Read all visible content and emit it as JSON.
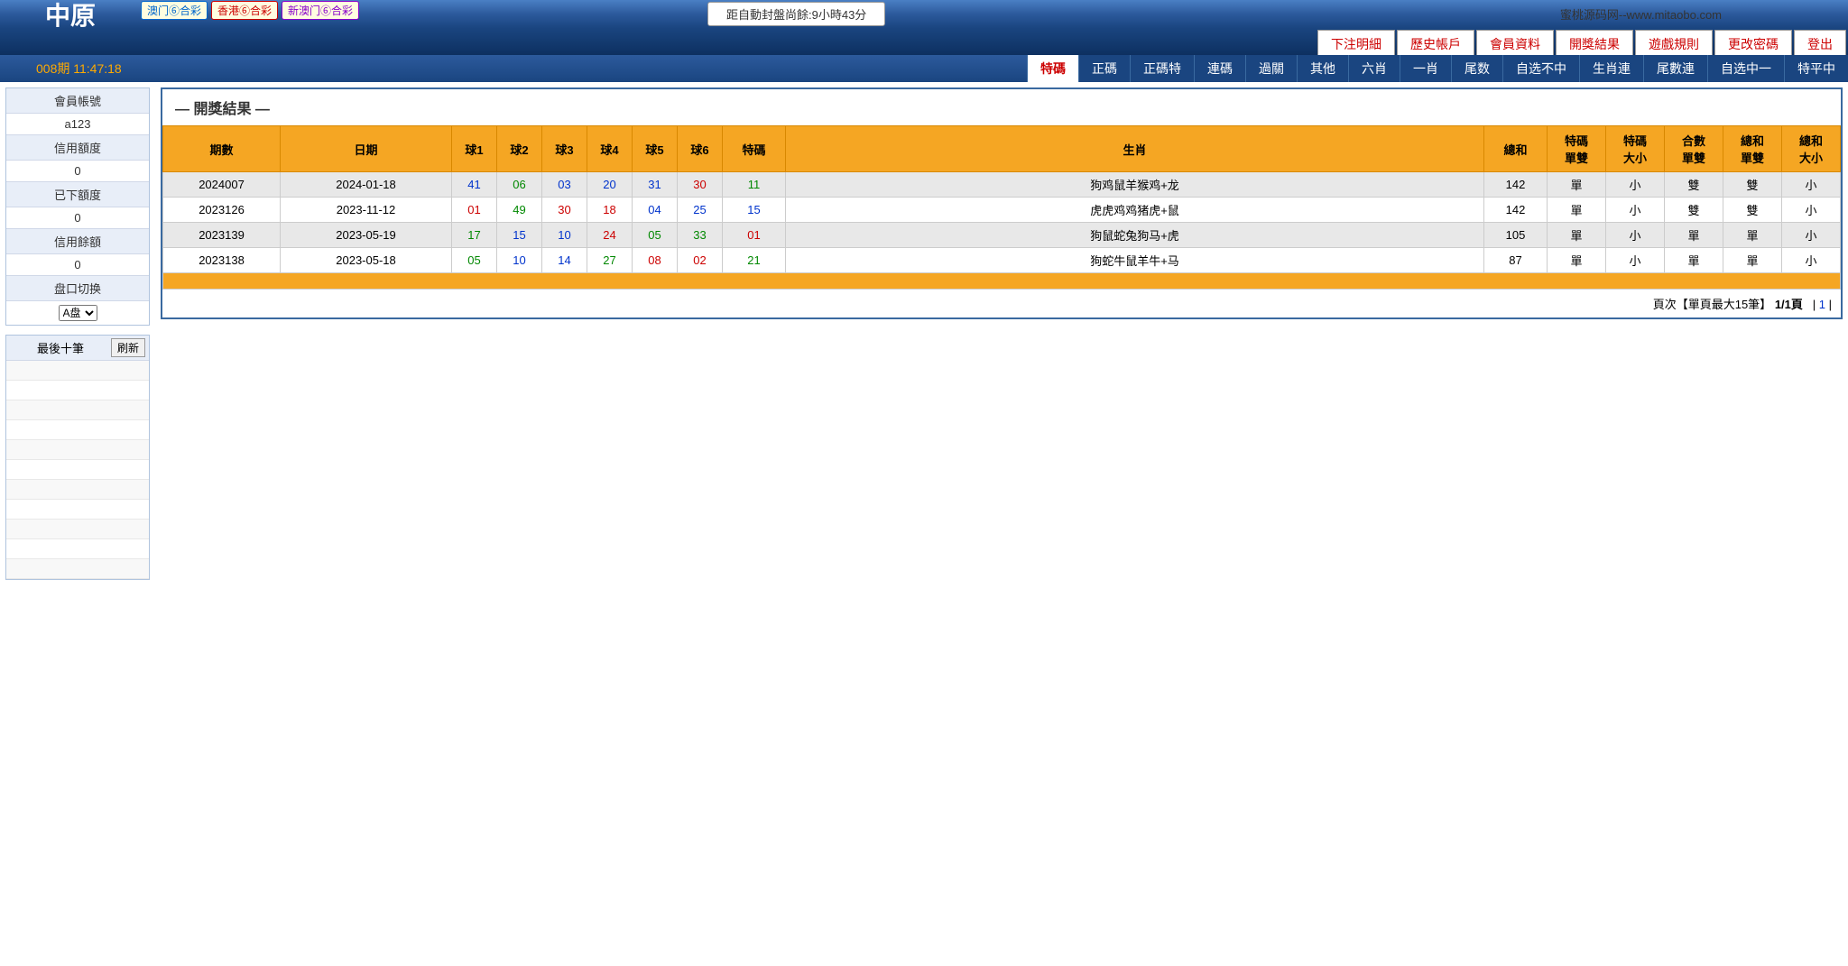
{
  "header": {
    "logo": "中原",
    "badges": [
      "澳门⑥合彩",
      "香港⑥合彩",
      "新澳门⑥合彩"
    ],
    "countdown": "距自動封盤尚餘:9小時43分",
    "site_info": "蜜桃源码网--www.mitaobo.com",
    "period_time": "008期 11:47:18"
  },
  "top_menu": [
    "下注明細",
    "歷史帳戶",
    "會員資料",
    "開獎結果",
    "遊戲規則",
    "更改密碼",
    "登出"
  ],
  "main_tabs": [
    "特碼",
    "正碼",
    "正碼特",
    "連碼",
    "過關",
    "其他",
    "六肖",
    "一肖",
    "尾数",
    "自选不中",
    "生肖連",
    "尾數連",
    "自选中一",
    "特平中"
  ],
  "active_tab_index": 0,
  "sidebar": {
    "labels": {
      "account": "會員帳號",
      "credit_limit": "信用額度",
      "placed": "已下額度",
      "remaining": "信用餘額",
      "market": "盘口切换"
    },
    "account_value": "a123",
    "credit_limit_value": "0",
    "placed_value": "0",
    "remaining_value": "0",
    "market_options": [
      "A盘"
    ],
    "recent_title": "最後十筆",
    "refresh_label": "刷新"
  },
  "results": {
    "title": "— 開獎結果 —",
    "headers": [
      "期數",
      "日期",
      "球1",
      "球2",
      "球3",
      "球4",
      "球5",
      "球6",
      "特碼",
      "生肖",
      "總和",
      "特碼單雙",
      "特碼大小",
      "合數單雙",
      "總和單雙",
      "總和大小"
    ],
    "rows": [
      {
        "period": "2024007",
        "date": "2024-01-18",
        "balls": [
          {
            "n": "41",
            "c": "blue"
          },
          {
            "n": "06",
            "c": "green"
          },
          {
            "n": "03",
            "c": "blue"
          },
          {
            "n": "20",
            "c": "blue"
          },
          {
            "n": "31",
            "c": "blue"
          },
          {
            "n": "30",
            "c": "red"
          },
          {
            "n": "11",
            "c": "green"
          }
        ],
        "zodiac": "狗鸡鼠羊猴鸡+龙",
        "sum": "142",
        "sp_oe": "單",
        "sp_bs": "小",
        "hs_oe": "雙",
        "sum_oe": "雙",
        "sum_bs": "小"
      },
      {
        "period": "2023126",
        "date": "2023-11-12",
        "balls": [
          {
            "n": "01",
            "c": "red"
          },
          {
            "n": "49",
            "c": "green"
          },
          {
            "n": "30",
            "c": "red"
          },
          {
            "n": "18",
            "c": "red"
          },
          {
            "n": "04",
            "c": "blue"
          },
          {
            "n": "25",
            "c": "blue"
          },
          {
            "n": "15",
            "c": "blue"
          }
        ],
        "zodiac": "虎虎鸡鸡猪虎+鼠",
        "sum": "142",
        "sp_oe": "單",
        "sp_bs": "小",
        "hs_oe": "雙",
        "sum_oe": "雙",
        "sum_bs": "小"
      },
      {
        "period": "2023139",
        "date": "2023-05-19",
        "balls": [
          {
            "n": "17",
            "c": "green"
          },
          {
            "n": "15",
            "c": "blue"
          },
          {
            "n": "10",
            "c": "blue"
          },
          {
            "n": "24",
            "c": "red"
          },
          {
            "n": "05",
            "c": "green"
          },
          {
            "n": "33",
            "c": "green"
          },
          {
            "n": "01",
            "c": "red"
          }
        ],
        "zodiac": "狗鼠蛇兔狗马+虎",
        "sum": "105",
        "sp_oe": "單",
        "sp_bs": "小",
        "hs_oe": "單",
        "sum_oe": "單",
        "sum_bs": "小"
      },
      {
        "period": "2023138",
        "date": "2023-05-18",
        "balls": [
          {
            "n": "05",
            "c": "green"
          },
          {
            "n": "10",
            "c": "blue"
          },
          {
            "n": "14",
            "c": "blue"
          },
          {
            "n": "27",
            "c": "green"
          },
          {
            "n": "08",
            "c": "red"
          },
          {
            "n": "02",
            "c": "red"
          },
          {
            "n": "21",
            "c": "green"
          }
        ],
        "zodiac": "狗蛇牛鼠羊牛+马",
        "sum": "87",
        "sp_oe": "單",
        "sp_bs": "小",
        "hs_oe": "單",
        "sum_oe": "單",
        "sum_bs": "小"
      }
    ],
    "pagination": {
      "text_prefix": "頁次【單頁最大15筆】",
      "page_info": "1/1頁",
      "sep": "|",
      "page_link": "1"
    }
  }
}
